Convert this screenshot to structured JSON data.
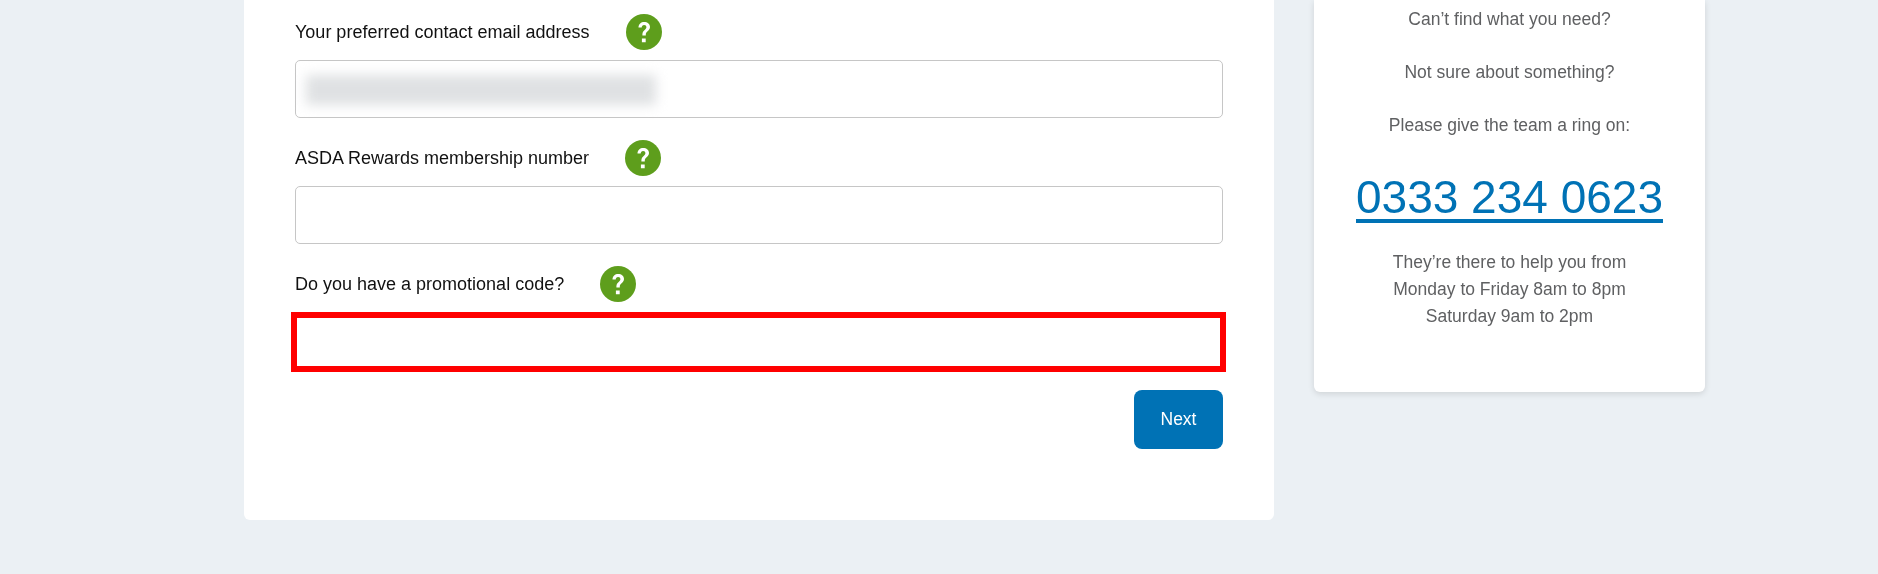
{
  "form": {
    "fields": [
      {
        "label": "Your preferred contact email address",
        "value_redacted": true,
        "highlighted": false
      },
      {
        "label": "ASDA Rewards membership number",
        "value_redacted": false,
        "highlighted": false
      },
      {
        "label": "Do you have a promotional code?",
        "value_redacted": false,
        "highlighted": true
      }
    ],
    "button": "Next"
  },
  "help_panel": {
    "lines": [
      "Can’t find what you need?",
      "Not sure about something?",
      "Please give the team a ring on:"
    ],
    "phone": "0333 234 0623",
    "hours": [
      "They’re there to help you from",
      "Monday to Friday 8am to 8pm",
      "Saturday 9am to 2pm"
    ]
  }
}
